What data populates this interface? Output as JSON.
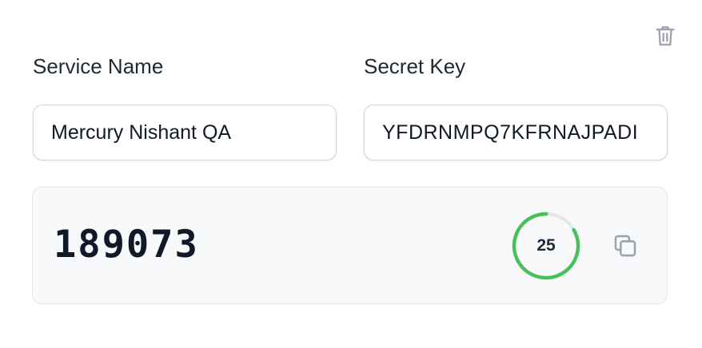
{
  "fields": {
    "service_name_label": "Service Name",
    "service_name_value": "Mercury Nishant QA",
    "secret_key_label": "Secret Key",
    "secret_key_value": "YFDRNMPQ7KFRNAJPADI"
  },
  "otp": {
    "code": "189073",
    "seconds_remaining": "25",
    "period_seconds": 30,
    "progress_color": "#4ac05c",
    "track_color": "#e5e7eb"
  },
  "icons": {
    "delete": "trash-icon",
    "copy": "copy-icon"
  }
}
